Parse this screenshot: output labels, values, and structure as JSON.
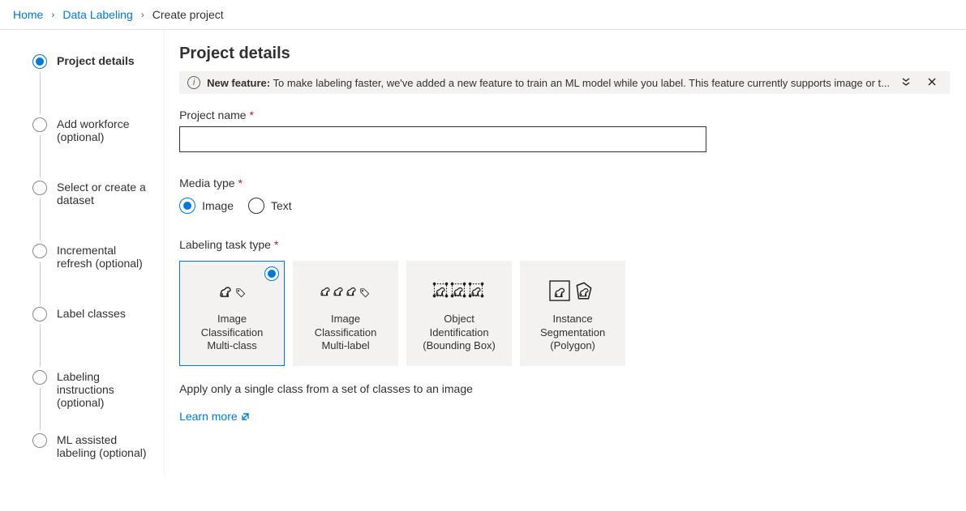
{
  "breadcrumb": {
    "items": [
      {
        "label": "Home",
        "link": true
      },
      {
        "label": "Data Labeling",
        "link": true
      },
      {
        "label": "Create project",
        "link": false
      }
    ]
  },
  "sidebar": {
    "steps": [
      {
        "label": "Project details",
        "active": true
      },
      {
        "label": "Add workforce (optional)",
        "active": false
      },
      {
        "label": "Select or create a dataset",
        "active": false
      },
      {
        "label": "Incremental refresh (optional)",
        "active": false
      },
      {
        "label": "Label classes",
        "active": false
      },
      {
        "label": "Labeling instructions (optional)",
        "active": false
      },
      {
        "label": "ML assisted labeling (optional)",
        "active": false
      }
    ]
  },
  "page": {
    "title": "Project details",
    "info_prefix": "New feature:",
    "info_text": "To make labeling faster, we've added a new feature to train an ML model while you label. This feature currently supports image or t...",
    "project_name_label": "Project name",
    "project_name_value": "",
    "media_type_label": "Media type",
    "media_options": [
      {
        "label": "Image",
        "selected": true
      },
      {
        "label": "Text",
        "selected": false
      }
    ],
    "task_type_label": "Labeling task type",
    "task_cards": [
      {
        "line1": "Image",
        "line2": "Classification",
        "line3": "Multi-class",
        "selected": true,
        "icon": "single-dog-tag"
      },
      {
        "line1": "Image",
        "line2": "Classification",
        "line3": "Multi-label",
        "selected": false,
        "icon": "three-dogs-tag"
      },
      {
        "line1": "Object",
        "line2": "Identification",
        "line3": "(Bounding Box)",
        "selected": false,
        "icon": "three-dogs-bbox"
      },
      {
        "line1": "Instance",
        "line2": "Segmentation",
        "line3": "(Polygon)",
        "selected": false,
        "icon": "two-dogs-polygon"
      }
    ],
    "task_description": "Apply only a single class from a set of classes to an image",
    "learn_more": "Learn more"
  }
}
